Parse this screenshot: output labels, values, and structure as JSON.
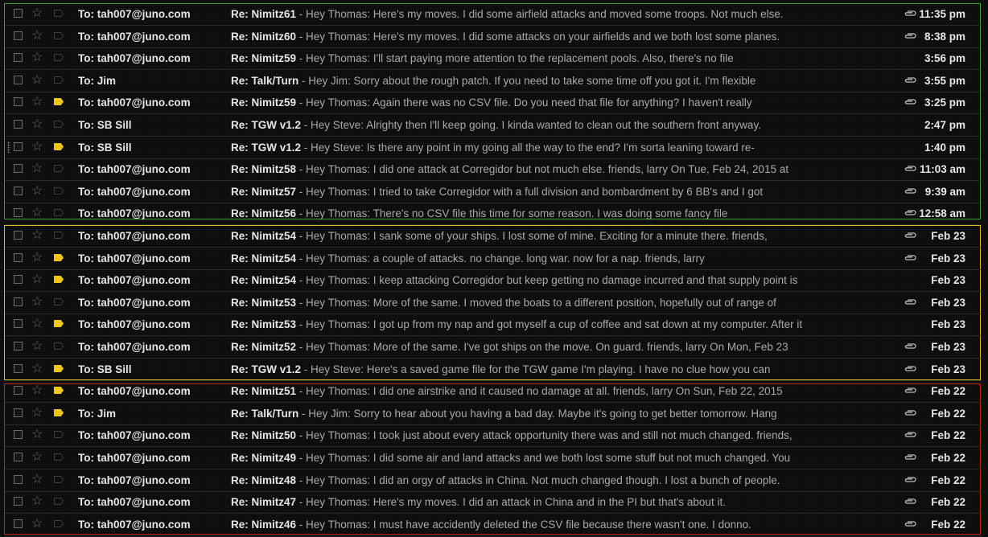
{
  "colors": {
    "group_recent": "#3aa12f",
    "group_feb23": "#d8c21a",
    "group_feb22": "#c0251c",
    "important_marker": "#f2c318"
  },
  "rows": [
    {
      "to": "To: tah007@juno.com",
      "subject": "Re: Nimitz61",
      "snippet": " - Hey Thomas: Here's my moves. I did some airfield attacks and moved some troops. Not much else.",
      "date": "11:35 pm",
      "attachment": true,
      "important": false
    },
    {
      "to": "To: tah007@juno.com",
      "subject": "Re: Nimitz60",
      "snippet": " - Hey Thomas: Here's my moves. I did some attacks on your airfields and we both lost some planes.",
      "date": "8:38 pm",
      "attachment": true,
      "important": false
    },
    {
      "to": "To: tah007@juno.com",
      "subject": "Re: Nimitz59",
      "snippet": " - Hey Thomas: I'll start paying more attention to the replacement pools. Also, there's no file",
      "date": "3:56 pm",
      "attachment": false,
      "important": false
    },
    {
      "to": "To: Jim",
      "subject": "Re: Talk/Turn",
      "snippet": " - Hey Jim: Sorry about the rough patch. If you need to take some time off you got it. I'm flexible",
      "date": "3:55 pm",
      "attachment": true,
      "important": false
    },
    {
      "to": "To: tah007@juno.com",
      "subject": "Re: Nimitz59",
      "snippet": " - Hey Thomas: Again there was no CSV file. Do you need that file for anything? I haven't really",
      "date": "3:25 pm",
      "attachment": true,
      "important": true
    },
    {
      "to": "To: SB Sill",
      "subject": "Re: TGW v1.2",
      "snippet": " - Hey Steve: Alrighty then I'll keep going. I kinda wanted to clean out the southern front anyway.",
      "date": "2:47 pm",
      "attachment": false,
      "important": false
    },
    {
      "to": "To: SB Sill",
      "subject": "Re: TGW v1.2",
      "snippet": " - Hey Steve: Is there any point in my going all the way to the end? I'm sorta leaning toward re-",
      "date": "1:40 pm",
      "attachment": false,
      "important": true
    },
    {
      "to": "To: tah007@juno.com",
      "subject": "Re: Nimitz58",
      "snippet": " - Hey Thomas: I did one attack at Corregidor but not much else. friends, larry On Tue, Feb 24, 2015 at",
      "date": "11:03 am",
      "attachment": true,
      "important": false
    },
    {
      "to": "To: tah007@juno.com",
      "subject": "Re: Nimitz57",
      "snippet": " - Hey Thomas: I tried to take Corregidor with a full division and bombardment by 6 BB's and I got",
      "date": "9:39 am",
      "attachment": true,
      "important": false
    },
    {
      "to": "To: tah007@juno.com",
      "subject": "Re: Nimitz56",
      "snippet": " - Hey Thomas: There's no CSV file this time for some reason. I was doing some fancy file",
      "date": "12:58 am",
      "attachment": true,
      "important": false
    },
    {
      "to": "To: tah007@juno.com",
      "subject": "Re: Nimitz54",
      "snippet": " - Hey Thomas: I sank some of your ships. I lost some of mine. Exciting for a minute there. friends,",
      "date": "Feb 23",
      "attachment": true,
      "important": false
    },
    {
      "to": "To: tah007@juno.com",
      "subject": "Re: Nimitz54",
      "snippet": " - Hey Thomas: a couple of attacks. no change. long war. now for a nap. friends, larry",
      "date": "Feb 23",
      "attachment": true,
      "important": true
    },
    {
      "to": "To: tah007@juno.com",
      "subject": "Re: Nimitz54",
      "snippet": " - Hey Thomas: I keep attacking Corregidor but keep getting no damage incurred and that supply point is",
      "date": "Feb 23",
      "attachment": false,
      "important": true
    },
    {
      "to": "To: tah007@juno.com",
      "subject": "Re: Nimitz53",
      "snippet": " - Hey Thomas: More of the same. I moved the boats to a different position, hopefully out of range of",
      "date": "Feb 23",
      "attachment": true,
      "important": false
    },
    {
      "to": "To: tah007@juno.com",
      "subject": "Re: Nimitz53",
      "snippet": " - Hey Thomas: I got up from my nap and got myself a cup of coffee and sat down at my computer. After it",
      "date": "Feb 23",
      "attachment": false,
      "important": true
    },
    {
      "to": "To: tah007@juno.com",
      "subject": "Re: Nimitz52",
      "snippet": " - Hey Thomas: More of the same. I've got ships on the move. On guard. friends, larry On Mon, Feb 23",
      "date": "Feb 23",
      "attachment": true,
      "important": false
    },
    {
      "to": "To: SB Sill",
      "subject": "Re: TGW v1.2",
      "snippet": " - Hey Steve: Here's a saved game file for the TGW game I'm playing. I have no clue how you can",
      "date": "Feb 23",
      "attachment": true,
      "important": true
    },
    {
      "to": "To: tah007@juno.com",
      "subject": "Re: Nimitz51",
      "snippet": " - Hey Thomas: I did one airstrike and it caused no damage at all. friends, larry On Sun, Feb 22, 2015",
      "date": "Feb 22",
      "attachment": true,
      "important": true
    },
    {
      "to": "To: Jim",
      "subject": "Re: Talk/Turn",
      "snippet": " - Hey Jim: Sorry to hear about you having a bad day. Maybe it's going to get better tomorrow. Hang",
      "date": "Feb 22",
      "attachment": true,
      "important": true
    },
    {
      "to": "To: tah007@juno.com",
      "subject": "Re: Nimitz50",
      "snippet": " - Hey Thomas: I took just about every attack opportunity there was and still not much changed. friends,",
      "date": "Feb 22",
      "attachment": true,
      "important": false
    },
    {
      "to": "To: tah007@juno.com",
      "subject": "Re: Nimitz49",
      "snippet": " - Hey Thomas: I did some air and land attacks and we both lost some stuff but not much changed. You",
      "date": "Feb 22",
      "attachment": true,
      "important": false
    },
    {
      "to": "To: tah007@juno.com",
      "subject": "Re: Nimitz48",
      "snippet": " - Hey Thomas: I did an orgy of attacks in China. Not much changed though. I lost a bunch of people.",
      "date": "Feb 22",
      "attachment": true,
      "important": false
    },
    {
      "to": "To: tah007@juno.com",
      "subject": "Re: Nimitz47",
      "snippet": " - Hey Thomas: Here's my moves. I did an attack in China and in the PI but that's about it.",
      "date": "Feb 22",
      "attachment": true,
      "important": false
    },
    {
      "to": "To: tah007@juno.com",
      "subject": "Re: Nimitz46",
      "snippet": " - Hey Thomas: I must have accidently deleted the CSV file because there wasn't one. I donno.",
      "date": "Feb 22",
      "attachment": true,
      "important": false
    }
  ]
}
